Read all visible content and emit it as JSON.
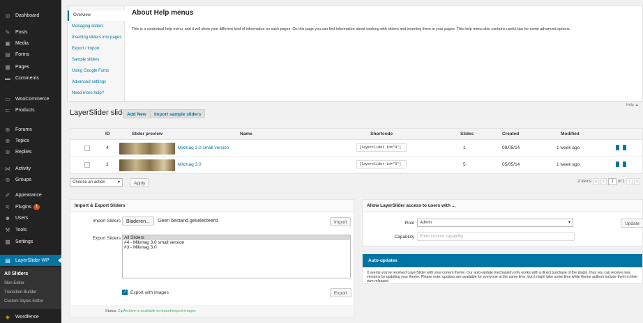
{
  "sidebar": {
    "items": [
      {
        "label": "Dashboard",
        "icon": "dashboard-icon",
        "glyph": "◎"
      },
      {
        "label": "Posts",
        "icon": "pin-icon",
        "glyph": "✎"
      },
      {
        "label": "Media",
        "icon": "media-icon",
        "glyph": "▣"
      },
      {
        "label": "Forms",
        "icon": "forms-icon",
        "glyph": "▤"
      },
      {
        "label": "Pages",
        "icon": "pages-icon",
        "glyph": "▦"
      },
      {
        "label": "Comments",
        "icon": "comments-icon",
        "glyph": "▬"
      },
      {
        "label": "WooCommerce",
        "icon": "woocommerce-icon",
        "glyph": "▭"
      },
      {
        "label": "Products",
        "icon": "products-icon",
        "glyph": "⊏"
      },
      {
        "label": "Forums",
        "icon": "forums-icon",
        "glyph": "⊕"
      },
      {
        "label": "Topics",
        "icon": "topics-icon",
        "glyph": "⊗"
      },
      {
        "label": "Replies",
        "icon": "replies-icon",
        "glyph": "⊛"
      },
      {
        "label": "Activity",
        "icon": "activity-icon",
        "glyph": "⋈"
      },
      {
        "label": "Groups",
        "icon": "groups-icon",
        "glyph": "⊛"
      },
      {
        "label": "Appearance",
        "icon": "appearance-icon",
        "glyph": "✐"
      },
      {
        "label": "Plugins",
        "icon": "plugins-icon",
        "glyph": "⚟",
        "badge": "1"
      },
      {
        "label": "Users",
        "icon": "users-icon",
        "glyph": "☻"
      },
      {
        "label": "Tools",
        "icon": "tools-icon",
        "glyph": "⚒"
      },
      {
        "label": "Settings",
        "icon": "settings-icon",
        "glyph": "▩"
      },
      {
        "label": "LayerSlider WP",
        "icon": "layerslider-icon",
        "glyph": "▤"
      },
      {
        "label": "Wordfence",
        "icon": "wordfence-icon",
        "glyph": "◈"
      }
    ],
    "submenu": [
      "All Sliders",
      "Skin Editor",
      "Transition Builder",
      "Custom Styles Editor"
    ]
  },
  "help": {
    "tabs": [
      "Overview",
      "Managing sliders",
      "Inserting sliders into pages",
      "Export / Import",
      "Sample sliders",
      "Using Google Fonts",
      "Advanced settings",
      "Need more help?"
    ],
    "title": "About Help menus",
    "text": "This is a contextual help menu, and it will show your different kind of information on each pages. On this page you can find information about working with sliders and inserting them to your pages. This help menu also contains useful tips for some advanced options.",
    "toggle": "Help ▲"
  },
  "header": {
    "title": "LayerSlider sliders",
    "add_new": "Add New",
    "import_sample": "Import sample sliders"
  },
  "table": {
    "headers": {
      "id": "ID",
      "preview": "Slider preview",
      "name": "Name",
      "shortcode": "Shortcode",
      "slides": "Slides",
      "created": "Created",
      "modified": "Modified"
    },
    "rows": [
      {
        "id": "4",
        "name": "Mikmag 3.0 small version",
        "shortcode": "[layerslider id=\"4\"]",
        "slides": "1",
        "created": "09/05/14",
        "modified": "1 week ago"
      },
      {
        "id": "3",
        "name": "Mikmag 3.0",
        "shortcode": "[layerslider id=\"3\"]",
        "slides": "5",
        "created": "05/05/14",
        "modified": "1 week ago"
      }
    ]
  },
  "bulk": {
    "select": "Choose an action",
    "apply": "Apply"
  },
  "pagination": {
    "items": "2 items",
    "first": "«",
    "prev": "‹",
    "current": "1",
    "of": "of 1",
    "next": "›",
    "last": "»"
  },
  "import_export": {
    "title": "Import & Export Sliders",
    "import_label": "Import Sliders",
    "browse": "Bladeren...",
    "no_file": "Geen bestand geselecteerd.",
    "import_btn": "Import",
    "export_label": "Export Sliders",
    "export_options": [
      "All Sliders",
      "#4   - Mikmag 3.0 small version",
      "#3   - Mikmag 3.0"
    ],
    "export_images": "Export with images",
    "export_btn": "Export",
    "status_label": "Status:",
    "status_value": "ZipArchive is available to import/export images"
  },
  "access": {
    "title": "Allow LayerSlider access to users with ...",
    "role_label": "Role",
    "role_value": "Admin",
    "update_btn": "Update",
    "capability_label": "Capability",
    "capability_placeholder": "Enter custom capability"
  },
  "autoupdates": {
    "title": "Auto-updates",
    "text": "It seems you've received LayerSlider with your current theme. Our auto-update mechanism only works with a direct purchase of the plugin, thus you can receive new versions by updating your theme. Please note, updates are available for everyone at the same time, but it might take some time while theme authors include them in their own releases."
  },
  "colors": {
    "accent": "#0074a2",
    "sidebar": "#222222",
    "badge": "#d54e21"
  }
}
